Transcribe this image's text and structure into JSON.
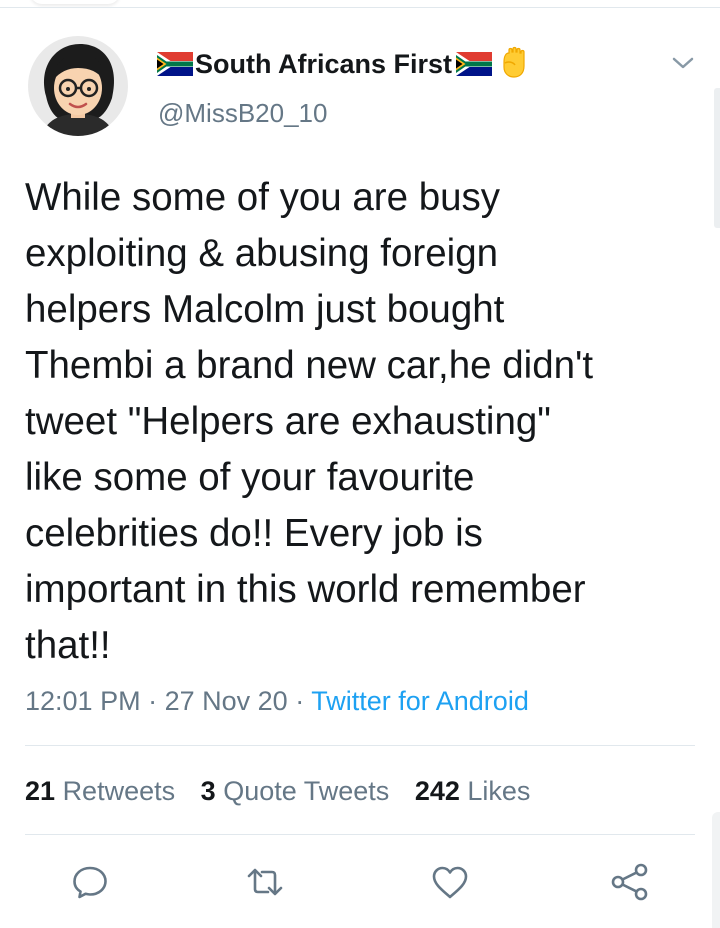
{
  "author": {
    "display_name": "South Africans First",
    "handle": "@MissB20_10",
    "icons": [
      "south-africa-flag-icon",
      "south-africa-flag-icon",
      "raised-fist-icon"
    ]
  },
  "tweet": {
    "lines": [
      "While some of you are busy",
      "exploiting & abusing foreign",
      "helpers Malcolm just bought",
      "Thembi a brand new car,he didn't",
      "tweet \"Helpers are exhausting\"",
      "like some of your favourite",
      "celebrities do!! Every job is",
      "important in this world remember",
      "that!!"
    ]
  },
  "meta": {
    "time": "12:01 PM",
    "separator": "·",
    "date": "27 Nov 20",
    "source": "Twitter for Android"
  },
  "stats": {
    "retweets_count": "21",
    "retweets_label": "Retweets",
    "quotes_count": "3",
    "quotes_label": "Quote Tweets",
    "likes_count": "242",
    "likes_label": "Likes"
  },
  "colors": {
    "text": "#14171a",
    "secondary": "#657786",
    "link": "#1da1f2",
    "divider": "#e1e8ed"
  },
  "actions": [
    "reply-icon",
    "retweet-icon",
    "like-icon",
    "share-icon"
  ]
}
